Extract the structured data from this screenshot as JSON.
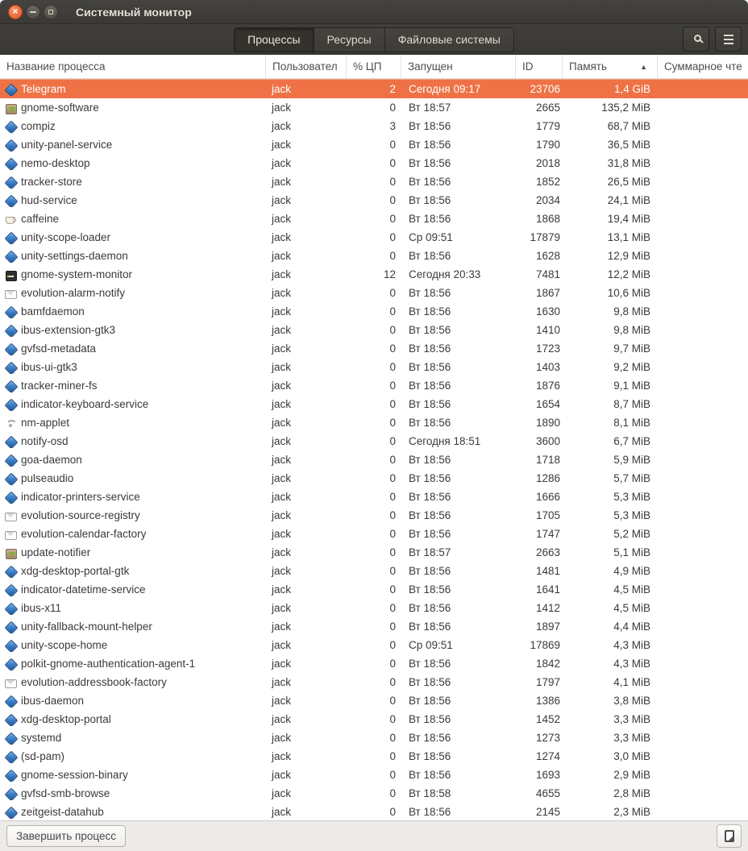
{
  "window": {
    "title": "Системный монитор",
    "controls": {
      "close": "×",
      "minimize": "–",
      "maximize": ""
    }
  },
  "tabs": [
    {
      "label": "Процессы",
      "active": true
    },
    {
      "label": "Ресурсы",
      "active": false
    },
    {
      "label": "Файловые системы",
      "active": false
    }
  ],
  "toolbar_icons": {
    "search": "search-icon",
    "menu": "menu-icon"
  },
  "columns": [
    {
      "label": "Название процесса"
    },
    {
      "label": "Пользовател"
    },
    {
      "label": "% ЦП"
    },
    {
      "label": "Запущен"
    },
    {
      "label": "ID"
    },
    {
      "label": "Память",
      "sort_arrow": "▲"
    },
    {
      "label": "Суммарное чте"
    }
  ],
  "selection_color": "#ee7245",
  "processes": [
    {
      "name": "Telegram",
      "icon": "app",
      "user": "jack",
      "cpu": "2",
      "started": "Сегодня 09:17",
      "id": "23706",
      "memory": "1,4 GiB",
      "disk_read": "",
      "selected": true
    },
    {
      "name": "gnome-software",
      "icon": "software",
      "user": "jack",
      "cpu": "0",
      "started": "Вт 18:57",
      "id": "2665",
      "memory": "135,2 MiB",
      "disk_read": "",
      "selected": false
    },
    {
      "name": "compiz",
      "icon": "app",
      "user": "jack",
      "cpu": "3",
      "started": "Вт 18:56",
      "id": "1779",
      "memory": "68,7 MiB",
      "disk_read": "",
      "selected": false
    },
    {
      "name": "unity-panel-service",
      "icon": "app",
      "user": "jack",
      "cpu": "0",
      "started": "Вт 18:56",
      "id": "1790",
      "memory": "36,5 MiB",
      "disk_read": "",
      "selected": false
    },
    {
      "name": "nemo-desktop",
      "icon": "app",
      "user": "jack",
      "cpu": "0",
      "started": "Вт 18:56",
      "id": "2018",
      "memory": "31,8 MiB",
      "disk_read": "",
      "selected": false
    },
    {
      "name": "tracker-store",
      "icon": "app",
      "user": "jack",
      "cpu": "0",
      "started": "Вт 18:56",
      "id": "1852",
      "memory": "26,5 MiB",
      "disk_read": "",
      "selected": false
    },
    {
      "name": "hud-service",
      "icon": "app",
      "user": "jack",
      "cpu": "0",
      "started": "Вт 18:56",
      "id": "2034",
      "memory": "24,1 MiB",
      "disk_read": "",
      "selected": false
    },
    {
      "name": "caffeine",
      "icon": "coffee",
      "user": "jack",
      "cpu": "0",
      "started": "Вт 18:56",
      "id": "1868",
      "memory": "19,4 MiB",
      "disk_read": "",
      "selected": false
    },
    {
      "name": "unity-scope-loader",
      "icon": "app",
      "user": "jack",
      "cpu": "0",
      "started": "Ср 09:51",
      "id": "17879",
      "memory": "13,1 MiB",
      "disk_read": "",
      "selected": false
    },
    {
      "name": "unity-settings-daemon",
      "icon": "app",
      "user": "jack",
      "cpu": "0",
      "started": "Вт 18:56",
      "id": "1628",
      "memory": "12,9 MiB",
      "disk_read": "",
      "selected": false
    },
    {
      "name": "gnome-system-monitor",
      "icon": "monitor",
      "user": "jack",
      "cpu": "12",
      "started": "Сегодня 20:33",
      "id": "7481",
      "memory": "12,2 MiB",
      "disk_read": "",
      "selected": false
    },
    {
      "name": "evolution-alarm-notify",
      "icon": "mail",
      "user": "jack",
      "cpu": "0",
      "started": "Вт 18:56",
      "id": "1867",
      "memory": "10,6 MiB",
      "disk_read": "",
      "selected": false
    },
    {
      "name": "bamfdaemon",
      "icon": "app",
      "user": "jack",
      "cpu": "0",
      "started": "Вт 18:56",
      "id": "1630",
      "memory": "9,8 MiB",
      "disk_read": "",
      "selected": false
    },
    {
      "name": "ibus-extension-gtk3",
      "icon": "app",
      "user": "jack",
      "cpu": "0",
      "started": "Вт 18:56",
      "id": "1410",
      "memory": "9,8 MiB",
      "disk_read": "",
      "selected": false
    },
    {
      "name": "gvfsd-metadata",
      "icon": "app",
      "user": "jack",
      "cpu": "0",
      "started": "Вт 18:56",
      "id": "1723",
      "memory": "9,7 MiB",
      "disk_read": "",
      "selected": false
    },
    {
      "name": "ibus-ui-gtk3",
      "icon": "app",
      "user": "jack",
      "cpu": "0",
      "started": "Вт 18:56",
      "id": "1403",
      "memory": "9,2 MiB",
      "disk_read": "",
      "selected": false
    },
    {
      "name": "tracker-miner-fs",
      "icon": "app",
      "user": "jack",
      "cpu": "0",
      "started": "Вт 18:56",
      "id": "1876",
      "memory": "9,1 MiB",
      "disk_read": "",
      "selected": false
    },
    {
      "name": "indicator-keyboard-service",
      "icon": "app",
      "user": "jack",
      "cpu": "0",
      "started": "Вт 18:56",
      "id": "1654",
      "memory": "8,7 MiB",
      "disk_read": "",
      "selected": false
    },
    {
      "name": "nm-applet",
      "icon": "wifi",
      "user": "jack",
      "cpu": "0",
      "started": "Вт 18:56",
      "id": "1890",
      "memory": "8,1 MiB",
      "disk_read": "",
      "selected": false
    },
    {
      "name": "notify-osd",
      "icon": "app",
      "user": "jack",
      "cpu": "0",
      "started": "Сегодня 18:51",
      "id": "3600",
      "memory": "6,7 MiB",
      "disk_read": "",
      "selected": false
    },
    {
      "name": "goa-daemon",
      "icon": "app",
      "user": "jack",
      "cpu": "0",
      "started": "Вт 18:56",
      "id": "1718",
      "memory": "5,9 MiB",
      "disk_read": "",
      "selected": false
    },
    {
      "name": "pulseaudio",
      "icon": "app",
      "user": "jack",
      "cpu": "0",
      "started": "Вт 18:56",
      "id": "1286",
      "memory": "5,7 MiB",
      "disk_read": "",
      "selected": false
    },
    {
      "name": "indicator-printers-service",
      "icon": "app",
      "user": "jack",
      "cpu": "0",
      "started": "Вт 18:56",
      "id": "1666",
      "memory": "5,3 MiB",
      "disk_read": "",
      "selected": false
    },
    {
      "name": "evolution-source-registry",
      "icon": "mail",
      "user": "jack",
      "cpu": "0",
      "started": "Вт 18:56",
      "id": "1705",
      "memory": "5,3 MiB",
      "disk_read": "",
      "selected": false
    },
    {
      "name": "evolution-calendar-factory",
      "icon": "mail",
      "user": "jack",
      "cpu": "0",
      "started": "Вт 18:56",
      "id": "1747",
      "memory": "5,2 MiB",
      "disk_read": "",
      "selected": false
    },
    {
      "name": "update-notifier",
      "icon": "software",
      "user": "jack",
      "cpu": "0",
      "started": "Вт 18:57",
      "id": "2663",
      "memory": "5,1 MiB",
      "disk_read": "",
      "selected": false
    },
    {
      "name": "xdg-desktop-portal-gtk",
      "icon": "app",
      "user": "jack",
      "cpu": "0",
      "started": "Вт 18:56",
      "id": "1481",
      "memory": "4,9 MiB",
      "disk_read": "",
      "selected": false
    },
    {
      "name": "indicator-datetime-service",
      "icon": "app",
      "user": "jack",
      "cpu": "0",
      "started": "Вт 18:56",
      "id": "1641",
      "memory": "4,5 MiB",
      "disk_read": "",
      "selected": false
    },
    {
      "name": "ibus-x11",
      "icon": "app",
      "user": "jack",
      "cpu": "0",
      "started": "Вт 18:56",
      "id": "1412",
      "memory": "4,5 MiB",
      "disk_read": "",
      "selected": false
    },
    {
      "name": "unity-fallback-mount-helper",
      "icon": "app",
      "user": "jack",
      "cpu": "0",
      "started": "Вт 18:56",
      "id": "1897",
      "memory": "4,4 MiB",
      "disk_read": "",
      "selected": false
    },
    {
      "name": "unity-scope-home",
      "icon": "app",
      "user": "jack",
      "cpu": "0",
      "started": "Ср 09:51",
      "id": "17869",
      "memory": "4,3 MiB",
      "disk_read": "",
      "selected": false
    },
    {
      "name": "polkit-gnome-authentication-agent-1",
      "icon": "app",
      "user": "jack",
      "cpu": "0",
      "started": "Вт 18:56",
      "id": "1842",
      "memory": "4,3 MiB",
      "disk_read": "",
      "selected": false
    },
    {
      "name": "evolution-addressbook-factory",
      "icon": "mail",
      "user": "jack",
      "cpu": "0",
      "started": "Вт 18:56",
      "id": "1797",
      "memory": "4,1 MiB",
      "disk_read": "",
      "selected": false
    },
    {
      "name": "ibus-daemon",
      "icon": "app",
      "user": "jack",
      "cpu": "0",
      "started": "Вт 18:56",
      "id": "1386",
      "memory": "3,8 MiB",
      "disk_read": "",
      "selected": false
    },
    {
      "name": "xdg-desktop-portal",
      "icon": "app",
      "user": "jack",
      "cpu": "0",
      "started": "Вт 18:56",
      "id": "1452",
      "memory": "3,3 MiB",
      "disk_read": "",
      "selected": false
    },
    {
      "name": "systemd",
      "icon": "app",
      "user": "jack",
      "cpu": "0",
      "started": "Вт 18:56",
      "id": "1273",
      "memory": "3,3 MiB",
      "disk_read": "",
      "selected": false
    },
    {
      "name": "(sd-pam)",
      "icon": "app",
      "user": "jack",
      "cpu": "0",
      "started": "Вт 18:56",
      "id": "1274",
      "memory": "3,0 MiB",
      "disk_read": "",
      "selected": false
    },
    {
      "name": "gnome-session-binary",
      "icon": "app",
      "user": "jack",
      "cpu": "0",
      "started": "Вт 18:56",
      "id": "1693",
      "memory": "2,9 MiB",
      "disk_read": "",
      "selected": false
    },
    {
      "name": "gvfsd-smb-browse",
      "icon": "app",
      "user": "jack",
      "cpu": "0",
      "started": "Вт 18:58",
      "id": "4655",
      "memory": "2,8 MiB",
      "disk_read": "",
      "selected": false
    },
    {
      "name": "zeitgeist-datahub",
      "icon": "app",
      "user": "jack",
      "cpu": "0",
      "started": "Вт 18:56",
      "id": "2145",
      "memory": "2,3 MiB",
      "disk_read": "",
      "selected": false
    }
  ],
  "statusbar": {
    "end_process_label": "Завершить процесс"
  }
}
